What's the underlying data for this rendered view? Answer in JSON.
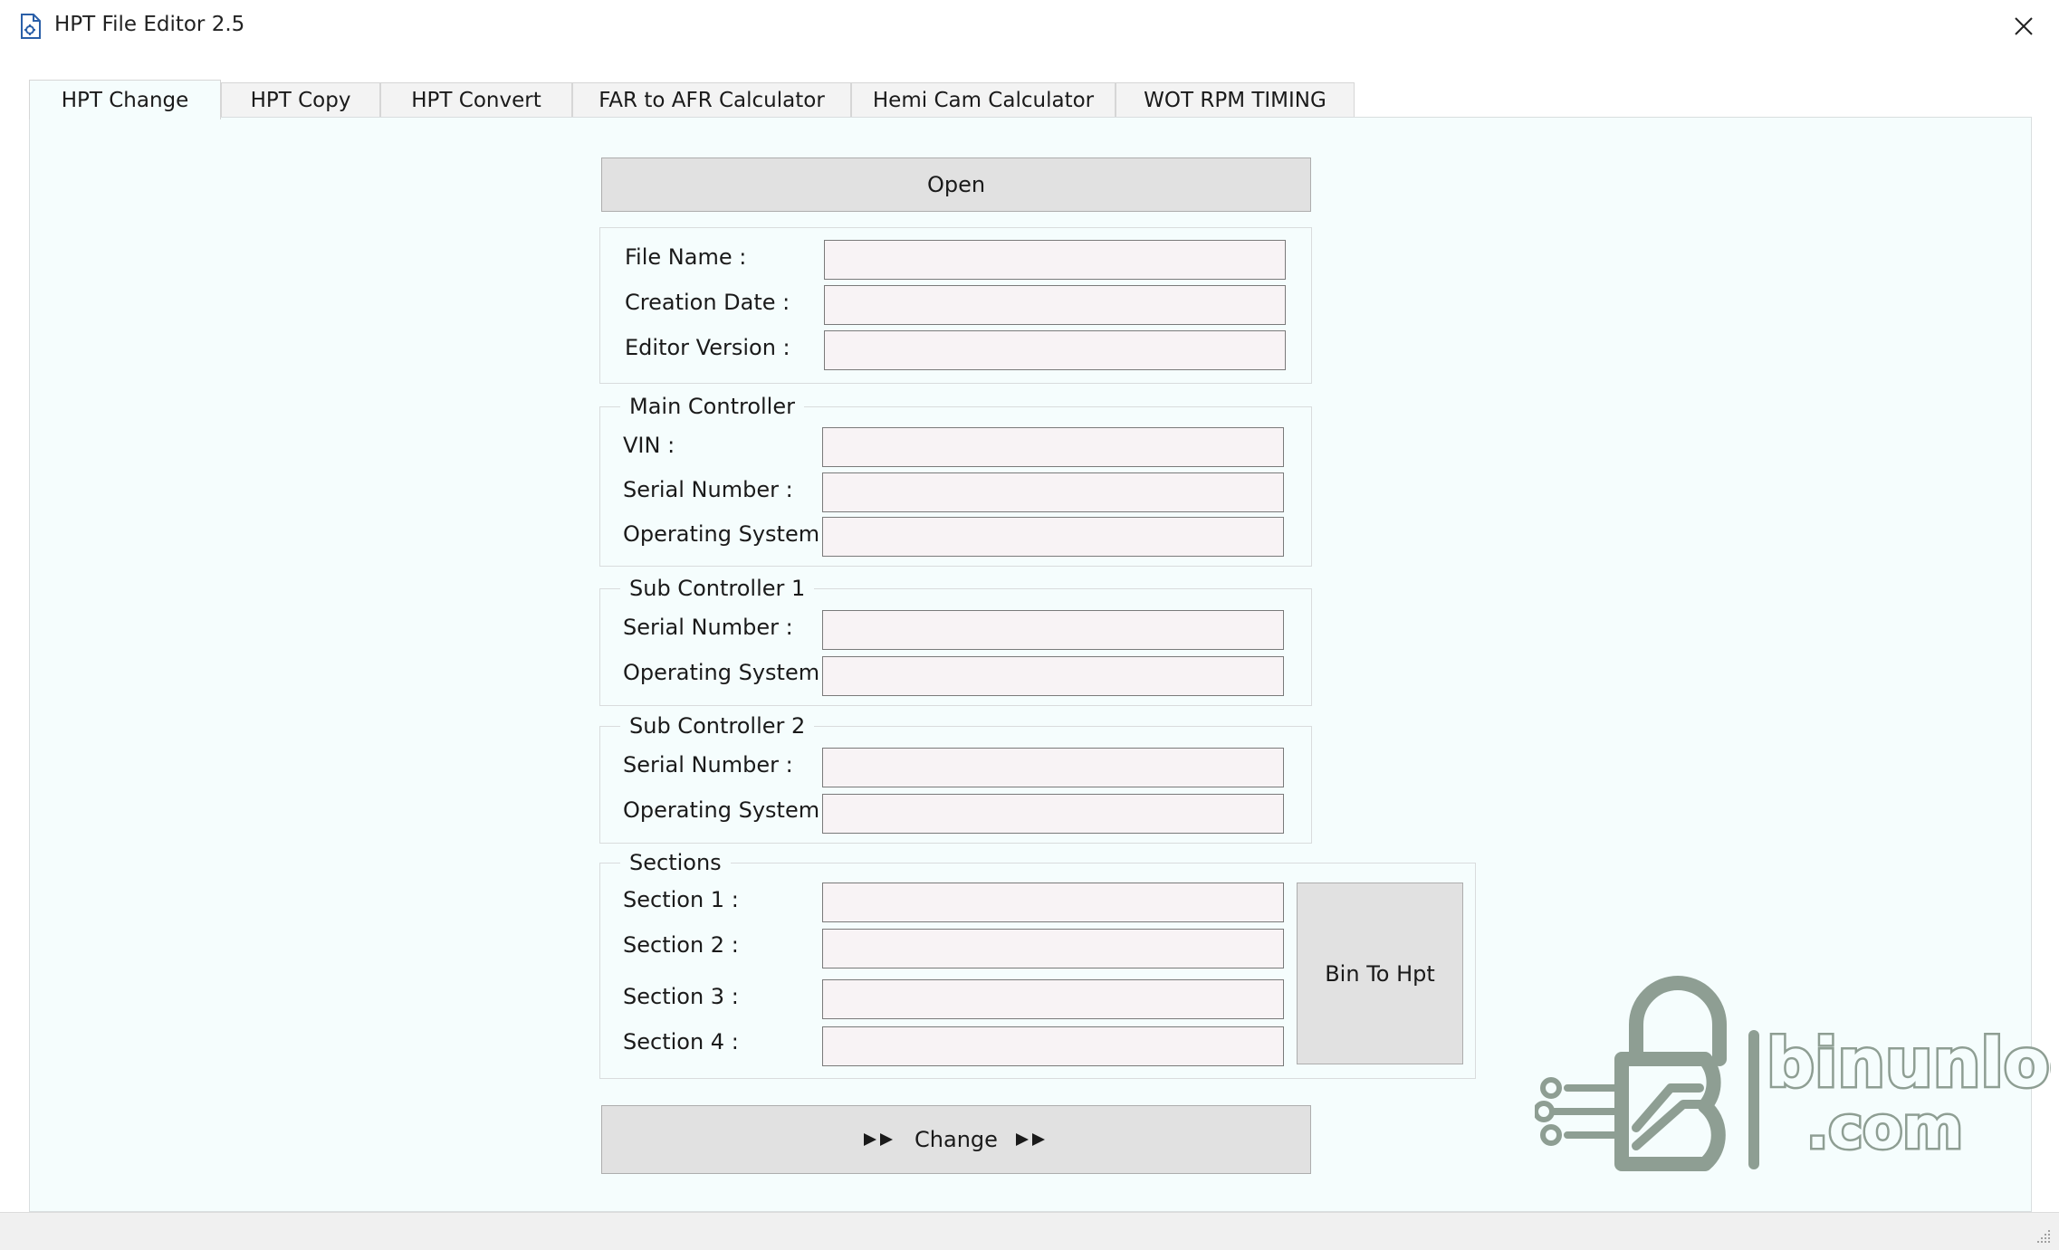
{
  "window": {
    "title": "HPT File Editor 2.5"
  },
  "tabs": [
    {
      "label": "HPT Change",
      "active": true
    },
    {
      "label": "HPT Copy",
      "active": false
    },
    {
      "label": "HPT Convert",
      "active": false
    },
    {
      "label": "FAR to AFR Calculator",
      "active": false
    },
    {
      "label": "Hemi Cam Calculator",
      "active": false
    },
    {
      "label": "WOT RPM TIMING",
      "active": false
    }
  ],
  "toolbar": {
    "open_label": "Open",
    "change_label": "Change"
  },
  "file_info": {
    "file_name_label": "File Name :",
    "file_name_value": "",
    "creation_date_label": "Creation Date :",
    "creation_date_value": "",
    "editor_version_label": "Editor Version :",
    "editor_version_value": ""
  },
  "main_controller": {
    "title": "Main Controller",
    "vin_label": "VIN :",
    "vin_value": "",
    "serial_label": "Serial Number :",
    "serial_value": "",
    "os_label": "Operating System :",
    "os_value": ""
  },
  "sub_controller_1": {
    "title": "Sub Controller 1",
    "serial_label": "Serial Number :",
    "serial_value": "",
    "os_label": "Operating System :",
    "os_value": ""
  },
  "sub_controller_2": {
    "title": "Sub Controller 2",
    "serial_label": "Serial Number :",
    "serial_value": "",
    "os_label": "Operating System :",
    "os_value": ""
  },
  "sections": {
    "title": "Sections",
    "items": [
      {
        "label": "Section 1 :",
        "value": ""
      },
      {
        "label": "Section 2 :",
        "value": ""
      },
      {
        "label": "Section 3 :",
        "value": ""
      },
      {
        "label": "Section 4 :",
        "value": ""
      }
    ],
    "bin_to_hpt_label": "Bin To Hpt"
  },
  "watermark": {
    "text_line1": "binunlock",
    "text_line2": ".com"
  },
  "colors": {
    "panel_bg": "#f5fdfd",
    "field_bg": "#f8f3f5",
    "button_bg": "#e1e1e1",
    "watermark": "#8e9e93"
  }
}
